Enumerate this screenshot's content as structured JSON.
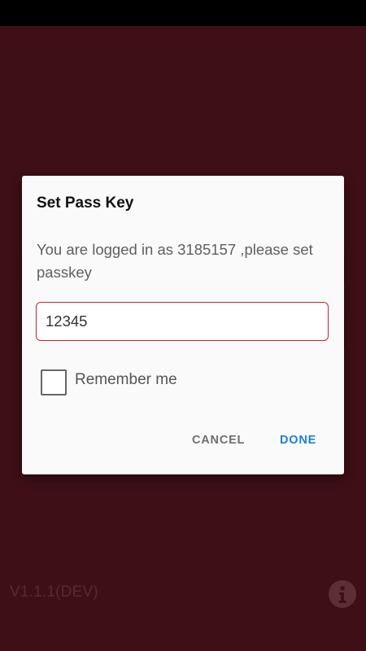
{
  "app": {
    "version": "V1.1.1(DEV)",
    "info_icon": "info-icon"
  },
  "dialog": {
    "title": "Set Pass Key",
    "message": "You are logged in as 3185157 ,please set passkey",
    "input": {
      "value": "12345",
      "placeholder": ""
    },
    "remember_label": "Remember me",
    "remember_checked": false,
    "cancel_label": "CANCEL",
    "done_label": "DONE"
  },
  "colors": {
    "background": "#3e0f16",
    "dialog": "#fafafa",
    "input_border": "#c62434",
    "done": "#1d7fd1",
    "cancel": "#6e6e6e"
  }
}
